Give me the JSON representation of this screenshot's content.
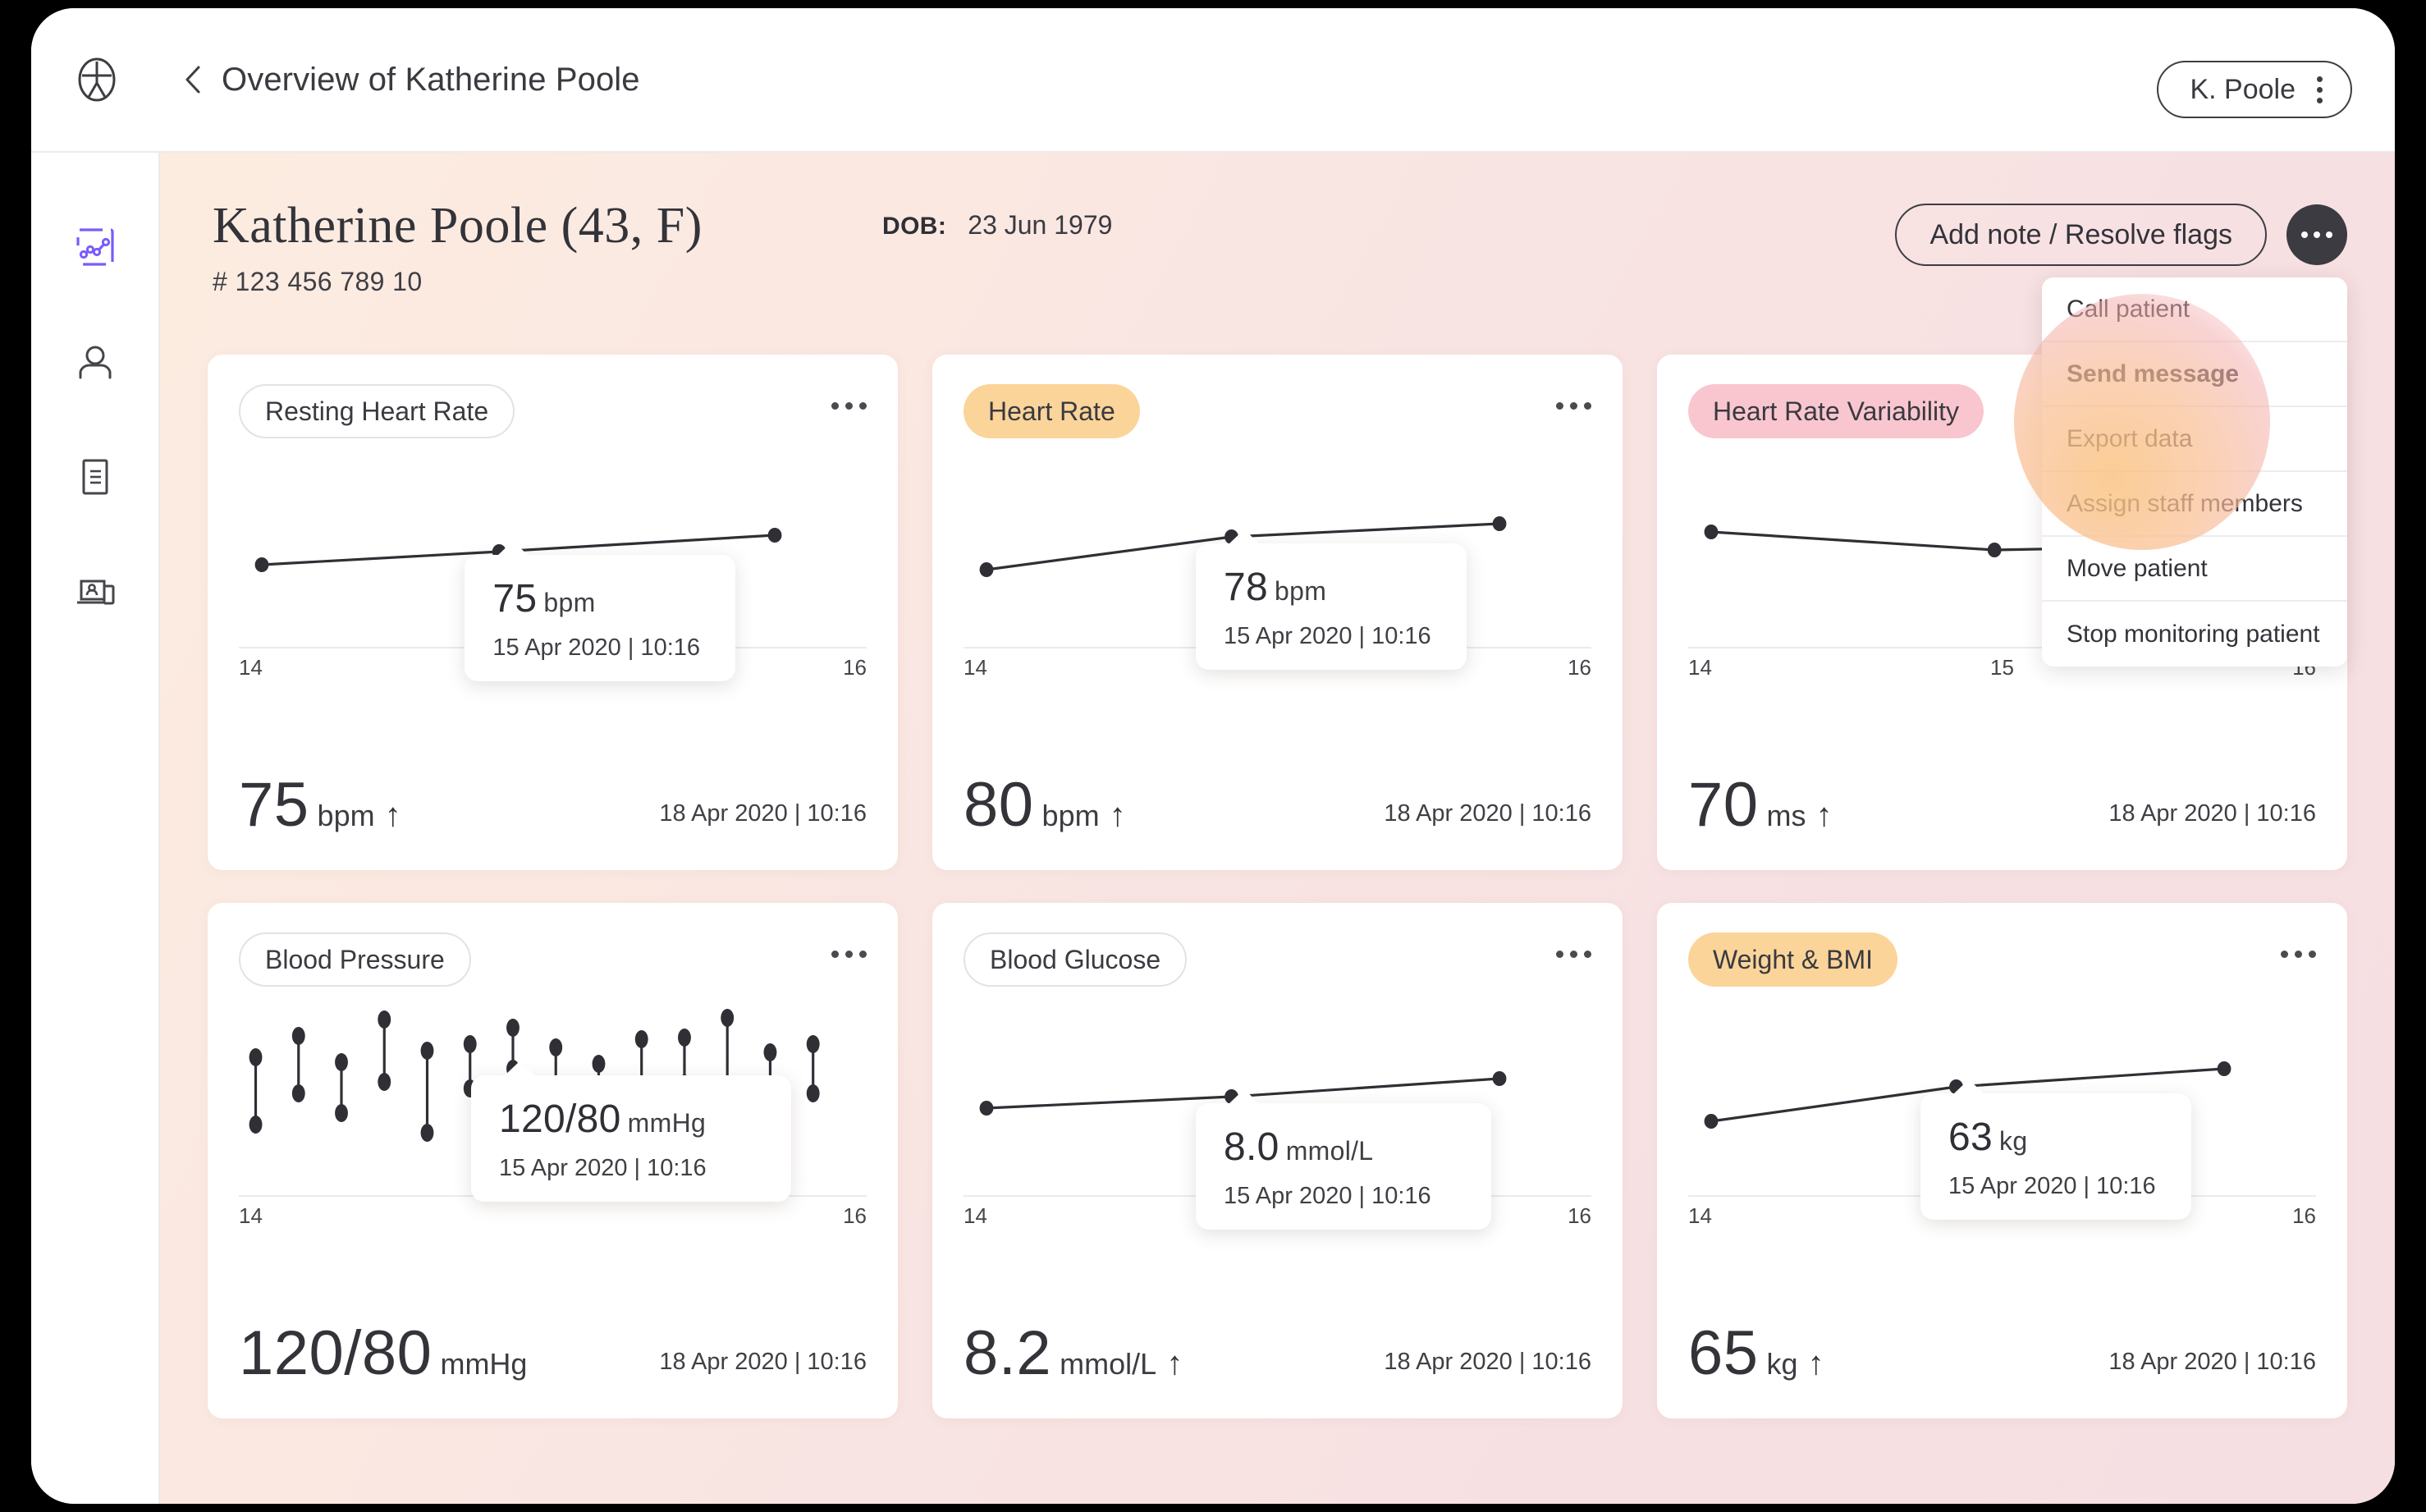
{
  "topbar": {
    "logo_icon": "person-circle-logo-icon",
    "back_icon": "chevron-left-icon",
    "breadcrumb_title": "Overview of Katherine Poole",
    "account_name": "K. Poole",
    "account_menu_icon": "vertical-dots-icon"
  },
  "sidebar": {
    "items": [
      {
        "icon": "chart-line-icon",
        "name": "monitoring",
        "active": true
      },
      {
        "icon": "person-icon",
        "name": "patients",
        "active": false
      },
      {
        "icon": "document-icon",
        "name": "reports",
        "active": false
      },
      {
        "icon": "devices-icon",
        "name": "devices",
        "active": false
      }
    ],
    "active_color": "#7b5bfa",
    "inactive_color": "#45454b"
  },
  "patient": {
    "name_line": "Katherine Poole (43,  F)",
    "id": "# 123 456 789 10",
    "dob_label": "DOB:",
    "dob_value": "23 Jun 1979"
  },
  "header_actions": {
    "add_note_label": "Add note / Resolve flags",
    "more_icon": "horizontal-dots-icon"
  },
  "dropdown": {
    "items": [
      {
        "label": "Call patient",
        "bold": false
      },
      {
        "label": "Send message",
        "bold": true
      },
      {
        "label": "Export data",
        "bold": false
      },
      {
        "label": "Assign staff members",
        "bold": false
      },
      {
        "label": "Move patient",
        "bold": false
      },
      {
        "label": "Stop monitoring patient",
        "bold": false
      }
    ]
  },
  "colors": {
    "badge_orange": "#fbd49a",
    "badge_pink": "#f9c6d0",
    "accent_purple": "#7b5bfa",
    "page_bg_left": "#fcece0",
    "page_bg_right": "#f6dfe2",
    "text_dark": "#33333a"
  },
  "cards": [
    {
      "title": "Resting Heart Rate",
      "badge_style": "outline",
      "menu_icon": "horizontal-dots-icon",
      "tooltip": {
        "value": "75",
        "unit": "bpm",
        "date": "15 Apr 2020 | 10:16"
      },
      "footer": {
        "value": "75",
        "unit": "bpm",
        "trend": "↑",
        "date": "18 Apr 2020 | 10:16"
      },
      "ticks": [
        "14",
        "16"
      ]
    },
    {
      "title": "Heart Rate",
      "badge_style": "orange",
      "menu_icon": "horizontal-dots-icon",
      "tooltip": {
        "value": "78",
        "unit": "bpm",
        "date": "15 Apr 2020 | 10:16"
      },
      "footer": {
        "value": "80",
        "unit": "bpm",
        "trend": "↑",
        "date": "18 Apr 2020 | 10:16"
      },
      "ticks": [
        "14",
        "16"
      ]
    },
    {
      "title": "Heart Rate Variability",
      "badge_style": "pink",
      "menu_icon": "horizontal-dots-icon",
      "tooltip": null,
      "footer": {
        "value": "70",
        "unit": "ms",
        "trend": "↑",
        "date": "18 Apr 2020 | 10:16"
      },
      "ticks": [
        "14",
        "15",
        "16"
      ]
    },
    {
      "title": "Blood Pressure",
      "badge_style": "outline",
      "menu_icon": "horizontal-dots-icon",
      "tooltip": {
        "value": "120/80",
        "unit": "mmHg",
        "date": "15 Apr 2020 | 10:16"
      },
      "footer": {
        "value": "120/80",
        "unit": "mmHg",
        "trend": "",
        "date": "18 Apr 2020 | 10:16"
      },
      "ticks": [
        "14",
        "16"
      ]
    },
    {
      "title": "Blood Glucose",
      "badge_style": "outline",
      "menu_icon": "horizontal-dots-icon",
      "tooltip": {
        "value": "8.0",
        "unit": "mmol/L",
        "date": "15 Apr 2020 | 10:16"
      },
      "footer": {
        "value": "8.2",
        "unit": "mmol/L",
        "trend": "↑",
        "date": "18 Apr 2020 | 10:16"
      },
      "ticks": [
        "14",
        "16"
      ]
    },
    {
      "title": "Weight & BMI",
      "badge_style": "orange",
      "menu_icon": "horizontal-dots-icon",
      "tooltip": {
        "value": "63",
        "unit": "kg",
        "date": "15 Apr 2020 | 10:16"
      },
      "footer": {
        "value": "65",
        "unit": "kg",
        "trend": "↑",
        "date": "18 Apr 2020 | 10:16"
      },
      "ticks": [
        "14",
        "16"
      ]
    }
  ],
  "chart_data": [
    {
      "type": "line",
      "title": "Resting Heart Rate",
      "xlabel": "",
      "ylabel": "bpm",
      "x": [
        14,
        15,
        16
      ],
      "values": [
        74,
        75,
        76
      ],
      "tick_labels": [
        "14",
        "16"
      ],
      "grid": false,
      "legend": false,
      "annotation": "75 bpm — 15 Apr 2020 | 10:16"
    },
    {
      "type": "line",
      "title": "Heart Rate",
      "xlabel": "",
      "ylabel": "bpm",
      "x": [
        14,
        15,
        16
      ],
      "values": [
        74,
        78,
        80
      ],
      "tick_labels": [
        "14",
        "16"
      ],
      "grid": false,
      "legend": false,
      "annotation": "78 bpm — 15 Apr 2020 | 10:16"
    },
    {
      "type": "line",
      "title": "Heart Rate Variability",
      "xlabel": "",
      "ylabel": "ms",
      "x": [
        14,
        15,
        16
      ],
      "values": [
        72,
        70,
        70
      ],
      "tick_labels": [
        "14",
        "15",
        "16"
      ],
      "grid": false,
      "legend": false
    },
    {
      "type": "range-dumbbell",
      "title": "Blood Pressure",
      "xlabel": "",
      "ylabel": "mmHg",
      "tick_labels": [
        "14",
        "16"
      ],
      "systolic": [
        124,
        133,
        121,
        140,
        126,
        130,
        137,
        129,
        122,
        131,
        133,
        139,
        127,
        128
      ],
      "diastolic": [
        80,
        86,
        76,
        88,
        72,
        83,
        89,
        85,
        82,
        86,
        84,
        90,
        88,
        84
      ],
      "grid": false,
      "legend": false,
      "annotation": "120/80 mmHg — 15 Apr 2020 | 10:16"
    },
    {
      "type": "line",
      "title": "Blood Glucose",
      "xlabel": "",
      "ylabel": "mmol/L",
      "x": [
        14,
        15,
        16
      ],
      "values": [
        7.8,
        8.0,
        8.2
      ],
      "tick_labels": [
        "14",
        "16"
      ],
      "grid": false,
      "legend": false,
      "annotation": "8.0 mmol/L — 15 Apr 2020 | 10:16"
    },
    {
      "type": "line",
      "title": "Weight & BMI",
      "xlabel": "",
      "ylabel": "kg",
      "x": [
        14,
        15,
        16
      ],
      "values": [
        61,
        63,
        65
      ],
      "tick_labels": [
        "14",
        "16"
      ],
      "grid": false,
      "legend": false,
      "annotation": "63 kg — 15 Apr 2020 | 10:16"
    }
  ]
}
